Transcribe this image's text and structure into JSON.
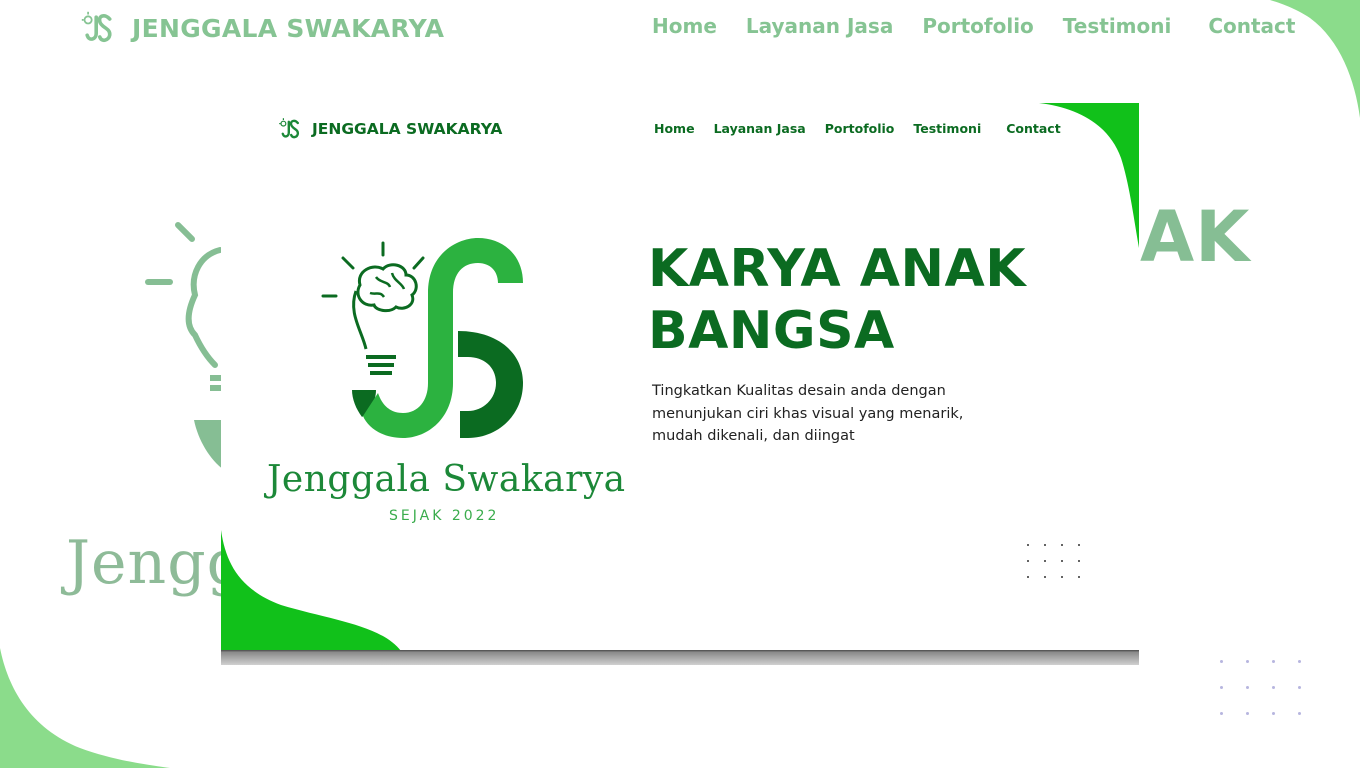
{
  "brand": {
    "name": "JENGGALA SWAKARYA",
    "logo_icon": "lightbulb-brain-js-logo-icon",
    "script_name": "Jenggala Swakarya",
    "since": "SEJAK 2022"
  },
  "nav": {
    "items": [
      {
        "label": "Home"
      },
      {
        "label": "Layanan Jasa"
      },
      {
        "label": "Portofolio"
      },
      {
        "label": "Testimoni"
      },
      {
        "label": "Contact"
      }
    ]
  },
  "hero": {
    "title_line1": "KARYA ANAK",
    "title_line2": "BANGSA",
    "description": "Tingkatkan Kualitas desain anda dengan menunjukan ciri khas visual yang menarik, mudah dikenali, dan diingat"
  },
  "background": {
    "partial_title": "AK",
    "partial_script": "Jengg"
  },
  "colors": {
    "primary_green": "#0b6b21",
    "accent_green": "#11c11a",
    "light_green": "#8bdc8b",
    "faded_green": "#86c493",
    "dot_color": "#b7b6df"
  }
}
